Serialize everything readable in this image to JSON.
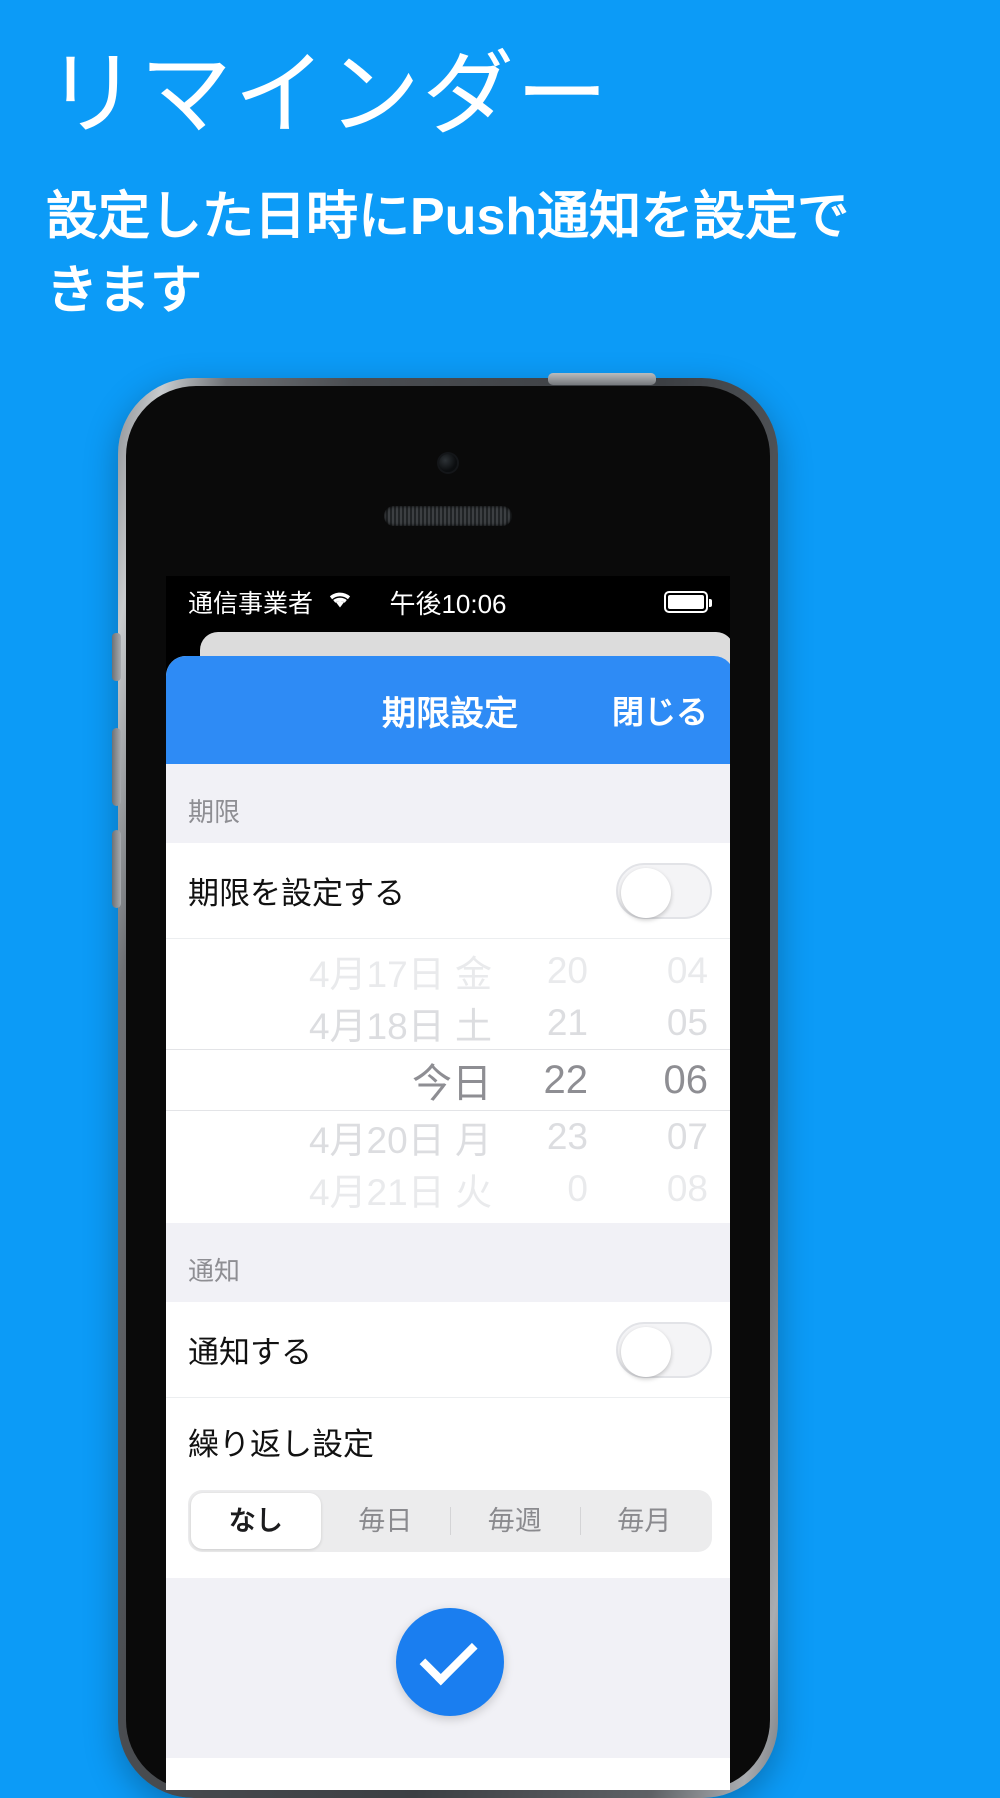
{
  "promo": {
    "title": "リマインダー",
    "subtitle": "設定した日時にPush通知を設定できます"
  },
  "status_bar": {
    "carrier": "通信事業者",
    "wifi_icon": "wifi-icon",
    "time": "午後10:06",
    "battery_icon": "battery-full-icon"
  },
  "sheet": {
    "title": "期限設定",
    "close_label": "閉じる",
    "accent_color": "#2e8bf5"
  },
  "deadline_section": {
    "header": "期限",
    "toggle_row_label": "期限を設定する",
    "toggle_on": false
  },
  "date_picker": {
    "rows": [
      {
        "date": "4月17日 金",
        "hour": "20",
        "minute": "04",
        "state": "faint-2"
      },
      {
        "date": "4月18日 土",
        "hour": "21",
        "minute": "05",
        "state": "faint-1"
      },
      {
        "date": "今日",
        "hour": "22",
        "minute": "06",
        "state": "selected"
      },
      {
        "date": "4月20日 月",
        "hour": "23",
        "minute": "07",
        "state": "faint-1"
      },
      {
        "date": "4月21日 火",
        "hour": "0",
        "minute": "08",
        "state": "faint-2"
      }
    ]
  },
  "notify_section": {
    "header": "通知",
    "toggle_row_label": "通知する",
    "toggle_on": false,
    "repeat_row_label": "繰り返し設定",
    "repeat_options": [
      "なし",
      "毎日",
      "毎週",
      "毎月"
    ],
    "repeat_selected": "なし"
  },
  "footer": {
    "confirm_icon": "check-icon"
  }
}
